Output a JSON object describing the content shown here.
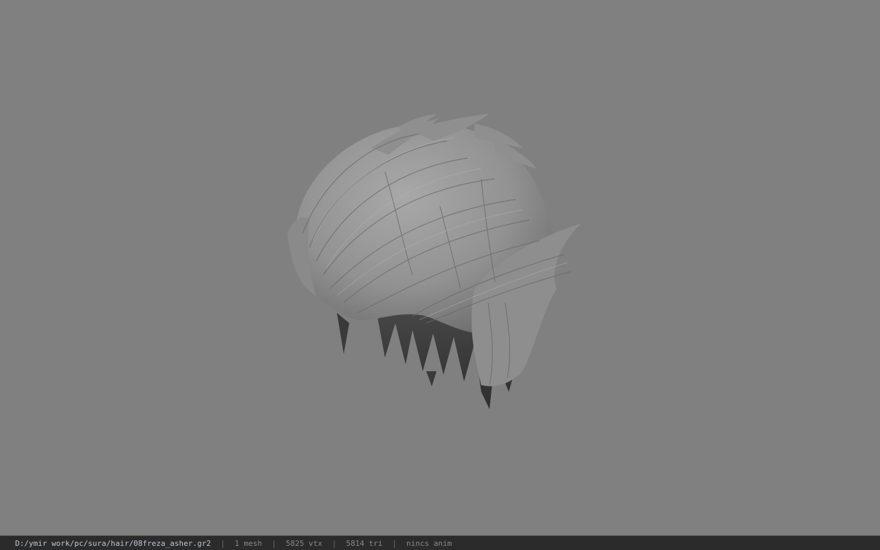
{
  "status_bar": {
    "file_path": "D:/ymir work/pc/sura/hair/08freza_asher.gr2",
    "mesh_count": "1 mesh",
    "vertex_count": "5825 vtx",
    "triangle_count": "5814 tri",
    "anim_status": "nincs anim",
    "separator": "|"
  },
  "viewport": {
    "background_color": "#808080",
    "model_color": "#9a9a9a",
    "model_shadow_color": "#3c3c3c"
  }
}
